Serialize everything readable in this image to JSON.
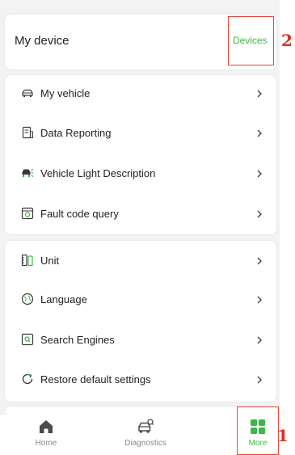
{
  "device": {
    "title": "My device",
    "devices_link": "Devices"
  },
  "menu_group_1": [
    {
      "label": "My vehicle",
      "icon": "car-outline-icon"
    },
    {
      "label": "Data Reporting",
      "icon": "report-document-icon"
    },
    {
      "label": "Vehicle Light Description",
      "icon": "vehicle-light-icon"
    },
    {
      "label": "Fault code query",
      "icon": "fault-code-icon"
    }
  ],
  "menu_group_2": [
    {
      "label": "Unit",
      "icon": "unit-icon"
    },
    {
      "label": "Language",
      "icon": "language-globe-icon"
    },
    {
      "label": "Search Engines",
      "icon": "search-engine-icon"
    },
    {
      "label": "Restore default settings",
      "icon": "restore-icon"
    }
  ],
  "tabbar": {
    "tabs": [
      {
        "label": "Home",
        "icon": "home-icon",
        "active": false
      },
      {
        "label": "Diagnostics",
        "icon": "diagnostics-car-icon",
        "active": false
      },
      {
        "label": "More",
        "icon": "more-grid-icon",
        "active": true
      }
    ]
  },
  "annotations": {
    "marker_devices": "2",
    "marker_more": "1"
  },
  "colors": {
    "accent": "#3fb64a",
    "annotation": "#d8302a",
    "background": "#f3f3f3"
  }
}
